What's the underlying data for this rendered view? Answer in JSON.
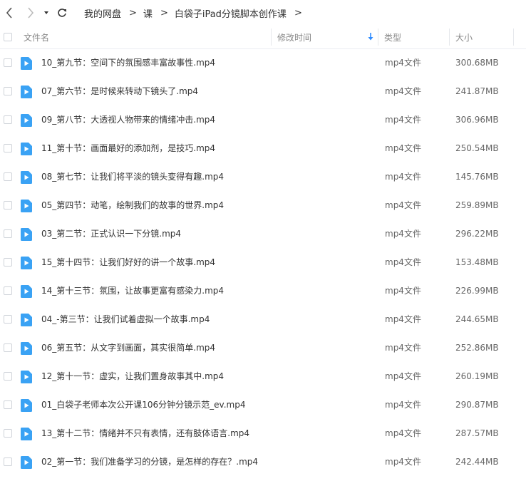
{
  "nav": {
    "back_icon": "chevron-left-icon",
    "forward_icon": "chevron-right-icon",
    "dropdown_icon": "triangle-down-icon",
    "refresh_icon": "refresh-icon"
  },
  "breadcrumb": [
    "我的网盘",
    "课",
    "白袋子iPad分镜脚本创作课"
  ],
  "breadcrumb_separator": ">",
  "columns": {
    "name": "文件名",
    "modified": "修改时间",
    "type": "类型",
    "size": "大小"
  },
  "sort_indicator": "arrow-down-icon",
  "colors": {
    "accent": "#2f8cff",
    "file_icon": "#3aa2f4"
  },
  "files": [
    {
      "name": "10_第九节：空间下的氛围感丰富故事性.mp4",
      "type": "mp4文件",
      "size": "300.68MB"
    },
    {
      "name": "07_第六节：是时候来转动下镜头了.mp4",
      "type": "mp4文件",
      "size": "241.87MB"
    },
    {
      "name": "09_第八节：大透视人物带来的情绪冲击.mp4",
      "type": "mp4文件",
      "size": "306.96MB"
    },
    {
      "name": "11_第十节：画面最好的添加剂，是技巧.mp4",
      "type": "mp4文件",
      "size": "250.54MB"
    },
    {
      "name": "08_第七节：让我们将平淡的镜头变得有趣.mp4",
      "type": "mp4文件",
      "size": "145.76MB"
    },
    {
      "name": "05_第四节：动笔，绘制我们的故事的世界.mp4",
      "type": "mp4文件",
      "size": "259.89MB"
    },
    {
      "name": "03_第二节：正式认识一下分镜.mp4",
      "type": "mp4文件",
      "size": "296.22MB"
    },
    {
      "name": "15_第十四节：让我们好好的讲一个故事.mp4",
      "type": "mp4文件",
      "size": "153.48MB"
    },
    {
      "name": "14_第十三节：氛围，让故事更富有感染力.mp4",
      "type": "mp4文件",
      "size": "226.99MB"
    },
    {
      "name": "04_-第三节：让我们试着虚拟一个故事.mp4",
      "type": "mp4文件",
      "size": "244.65MB"
    },
    {
      "name": "06_第五节：从文字到画面，其实很简单.mp4",
      "type": "mp4文件",
      "size": "252.86MB"
    },
    {
      "name": "12_第十一节：虚实，让我们置身故事其中.mp4",
      "type": "mp4文件",
      "size": "260.19MB"
    },
    {
      "name": "01_白袋子老师本次公开课106分钟分镜示范_ev.mp4",
      "type": "mp4文件",
      "size": "290.87MB"
    },
    {
      "name": "13_第十二节：情绪并不只有表情，还有肢体语言.mp4",
      "type": "mp4文件",
      "size": "287.57MB"
    },
    {
      "name": "02_第一节：我们准备学习的分镜，是怎样的存在？.mp4",
      "type": "mp4文件",
      "size": "242.44MB"
    }
  ]
}
